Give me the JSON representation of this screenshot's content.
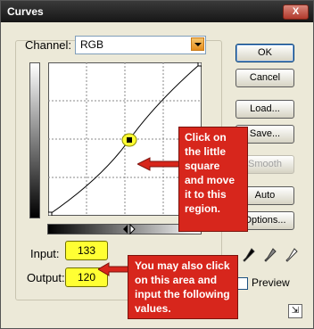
{
  "window": {
    "title": "Curves",
    "close_glyph": "X"
  },
  "channel": {
    "label": "Channel:",
    "value": "RGB"
  },
  "fields": {
    "input_label": "Input:",
    "input_value": "133",
    "output_label": "Output:",
    "output_value": "120"
  },
  "buttons": {
    "ok": "OK",
    "cancel": "Cancel",
    "load": "Load...",
    "save": "Save...",
    "smooth": "Smooth",
    "auto": "Auto",
    "options": "Options..."
  },
  "preview": {
    "label": "Preview",
    "checked": true
  },
  "callouts": {
    "top": "Click on the little square and move it to this region.",
    "bottom": "You may also click on this area and input the following values."
  },
  "colors": {
    "callout": "#d7261c",
    "highlight": "#ffff33"
  },
  "icons": {
    "close": "close-icon",
    "dropdown": "chevron-down-icon",
    "eyedroppers": [
      "black-eyedropper-icon",
      "gray-eyedropper-icon",
      "white-eyedropper-icon"
    ],
    "resize": "expand-icon"
  }
}
